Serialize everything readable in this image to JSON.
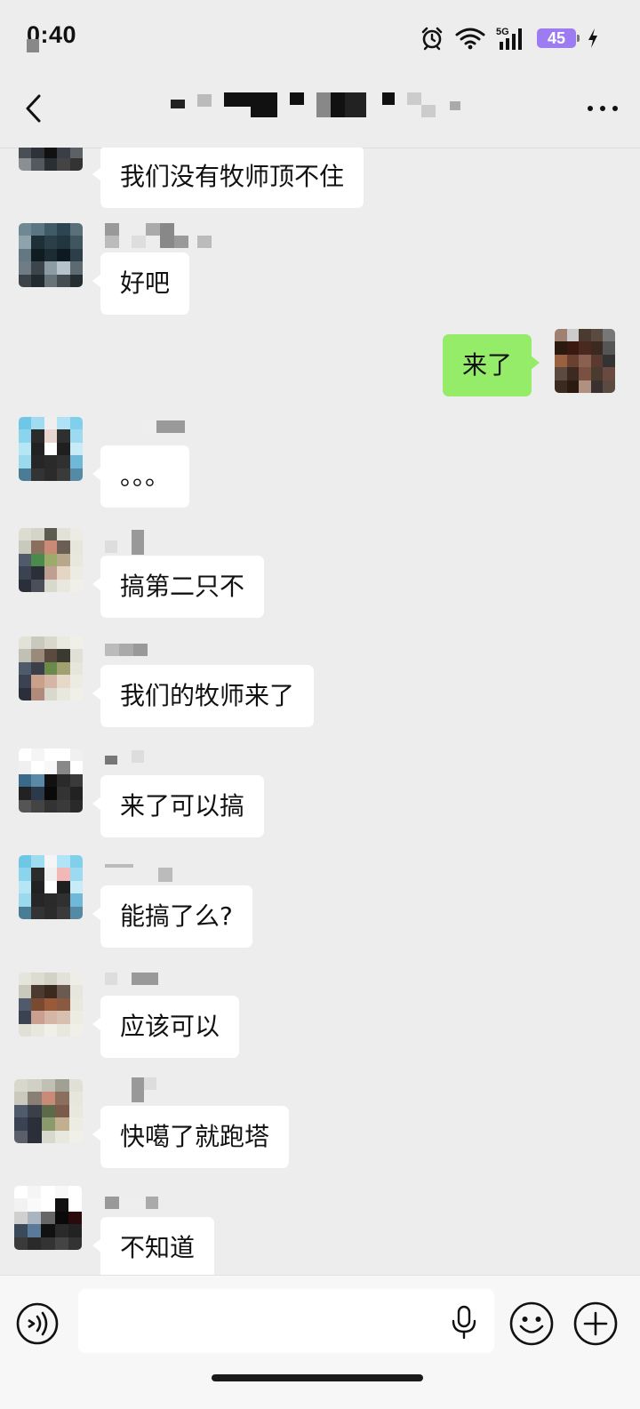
{
  "status_bar": {
    "time": "0:40",
    "battery": "45",
    "network": "5G"
  },
  "header": {
    "icons": [
      "back-icon",
      "more-icon"
    ]
  },
  "messages": [
    {
      "side": "left",
      "text": "我们没有牧师顶不住"
    },
    {
      "side": "left",
      "text": "好吧"
    },
    {
      "side": "right",
      "text": "来了"
    },
    {
      "side": "left",
      "text": "。。。"
    },
    {
      "side": "left",
      "text": "搞第二只不"
    },
    {
      "side": "left",
      "text": "我们的牧师来了"
    },
    {
      "side": "left",
      "text": "来了可以搞"
    },
    {
      "side": "left",
      "text": "能搞了么?"
    },
    {
      "side": "left",
      "text": "应该可以"
    },
    {
      "side": "left",
      "text": "快噶了就跑塔"
    },
    {
      "side": "left",
      "text": "不知道"
    }
  ],
  "input_bar": {
    "input_value": "",
    "icons": [
      "voice-icon",
      "mic-icon",
      "emoji-icon",
      "plus-icon"
    ]
  },
  "colors": {
    "background": "#ededed",
    "bubble_left": "#ffffff",
    "bubble_right": "#95ec69",
    "battery": "#9d7bf0"
  }
}
